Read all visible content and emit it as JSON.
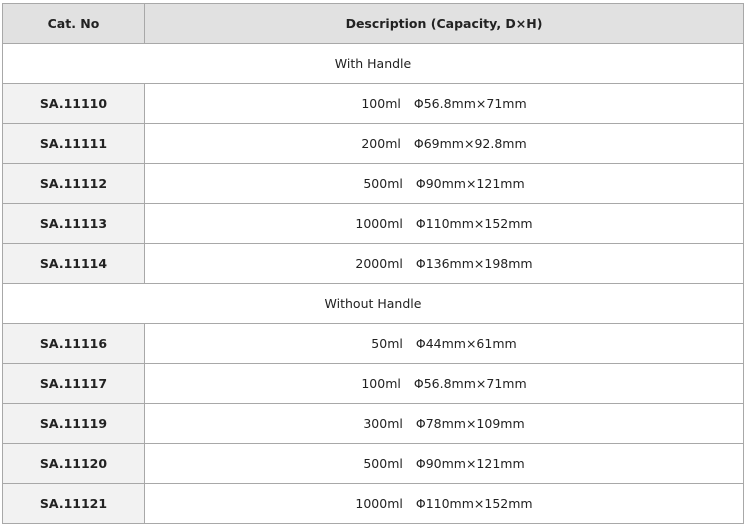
{
  "header": {
    "cat_no": "Cat. No",
    "description": "Description (Capacity, D×H)"
  },
  "sections": [
    {
      "title": "With Handle",
      "rows": [
        {
          "cat": "SA.11110",
          "capacity": "100ml",
          "dimensions": "Φ56.8mm×71mm"
        },
        {
          "cat": "SA.11111",
          "capacity": "200ml",
          "dimensions": "Φ69mm×92.8mm"
        },
        {
          "cat": "SA.11112",
          "capacity": "500ml",
          "dimensions": "Φ90mm×121mm"
        },
        {
          "cat": "SA.11113",
          "capacity": "1000ml",
          "dimensions": "Φ110mm×152mm"
        },
        {
          "cat": "SA.11114",
          "capacity": "2000ml",
          "dimensions": "Φ136mm×198mm"
        }
      ]
    },
    {
      "title": "Without Handle",
      "rows": [
        {
          "cat": "SA.11116",
          "capacity": "50ml",
          "dimensions": "Φ44mm×61mm"
        },
        {
          "cat": "SA.11117",
          "capacity": "100ml",
          "dimensions": "Φ56.8mm×71mm"
        },
        {
          "cat": "SA.11119",
          "capacity": "300ml",
          "dimensions": "Φ78mm×109mm"
        },
        {
          "cat": "SA.11120",
          "capacity": "500ml",
          "dimensions": "Φ90mm×121mm"
        },
        {
          "cat": "SA.11121",
          "capacity": "1000ml",
          "dimensions": "Φ110mm×152mm"
        }
      ]
    }
  ],
  "colors": {
    "header_bg": "#e1e1e1",
    "cat_bg": "#f2f2f2",
    "border": "#a8a8a8"
  }
}
